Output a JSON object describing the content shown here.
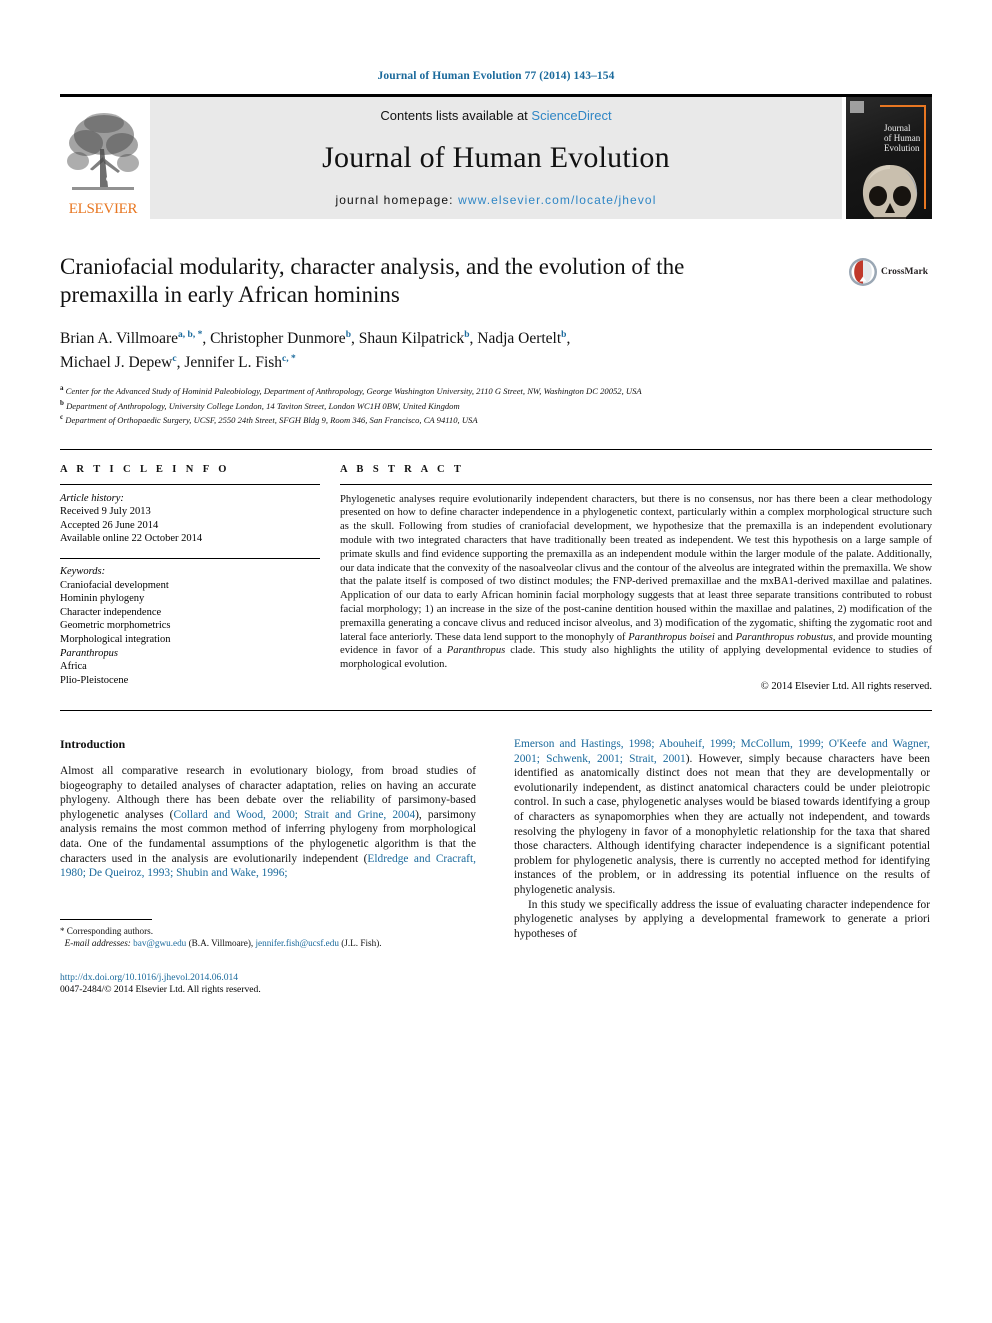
{
  "running_head": "Journal of Human Evolution 77 (2014) 143–154",
  "masthead": {
    "publisher": "ELSEVIER",
    "contents_prefix": "Contents lists available at ",
    "sciencedirect": "ScienceDirect",
    "journal_name": "Journal of Human Evolution",
    "homepage_label": "journal homepage: ",
    "homepage_url": "www.elsevier.com/locate/jhevol",
    "cover_title_line1": "Journal",
    "cover_title_line2": "of Human",
    "cover_title_line3": "Evolution"
  },
  "article": {
    "title": "Craniofacial modularity, character analysis, and the evolution of the premaxilla in early African hominins",
    "crossmark_label": "CrossMark",
    "authors_line1_parts": [
      {
        "name": "Brian A. Villmoare",
        "sup": "a, b, *"
      },
      {
        "name": "Christopher Dunmore",
        "sup": "b"
      },
      {
        "name": "Shaun Kilpatrick",
        "sup": "b"
      },
      {
        "name": "Nadja Oertelt",
        "sup": "b"
      }
    ],
    "authors_line2_parts": [
      {
        "name": "Michael J. Depew",
        "sup": "c"
      },
      {
        "name": "Jennifer L. Fish",
        "sup": "c, *"
      }
    ],
    "affiliations": [
      {
        "marker": "a",
        "text": "Center for the Advanced Study of Hominid Paleobiology, Department of Anthropology, George Washington University, 2110 G Street, NW, Washington DC 20052, USA"
      },
      {
        "marker": "b",
        "text": "Department of Anthropology, University College London, 14 Taviton Street, London WC1H 0BW, United Kingdom"
      },
      {
        "marker": "c",
        "text": "Department of Orthopaedic Surgery, UCSF, 2550 24th Street, SFGH Bldg 9, Room 346, San Francisco, CA 94110, USA"
      }
    ]
  },
  "article_info": {
    "heading": "A R T I C L E   I N F O",
    "history_label": "Article history:",
    "history": [
      "Received 9 July 2013",
      "Accepted 26 June 2014",
      "Available online 22 October 2014"
    ],
    "keywords_label": "Keywords:",
    "keywords": [
      "Craniofacial development",
      "Hominin phylogeny",
      "Character independence",
      "Geometric morphometrics",
      "Morphological integration",
      "Paranthropus",
      "Africa",
      "Plio-Pleistocene"
    ],
    "italic_keywords": [
      "Paranthropus"
    ]
  },
  "abstract": {
    "heading": "A B S T R A C T",
    "paragraph_1": "Phylogenetic analyses require evolutionarily independent characters, but there is no consensus, nor has there been a clear methodology presented on how to define character independence in a phylogenetic context, particularly within a complex morphological structure such as the skull. Following from studies of craniofacial development, we hypothesize that the premaxilla is an independent evolutionary module with two integrated characters that have traditionally been treated as independent. We test this hypothesis on a large sample of primate skulls and find evidence supporting the premaxilla as an independent module within the larger module of the palate. Additionally, our data indicate that the convexity of the nasoalveolar clivus and the contour of the alveolus are integrated within the premaxilla. We show that the palate itself is composed of two distinct modules; the FNP-derived premaxillae and the mxBA1-derived maxillae and palatines. Application of our data to early African hominin facial morphology suggests that at least three separate transitions contributed to robust facial morphology; 1) an increase in the size of the post-canine dentition housed within the maxillae and palatines, 2) modification of the premaxilla generating a concave clivus and reduced incisor alveolus, and 3) modification of the zygomatic, shifting the zygomatic root and lateral face anteriorly. These data lend support to the monophyly of ",
    "italic_1": "Paranthropus boisei",
    "mid_1": " and ",
    "italic_2": "Paranthropus robustus",
    "mid_2": ", and provide mounting evidence in favor of a ",
    "italic_3": "Paranthropus",
    "tail": " clade. This study also highlights the utility of applying developmental evidence to studies of morphological evolution.",
    "copyright": "© 2014 Elsevier Ltd. All rights reserved."
  },
  "body": {
    "heading": "Introduction",
    "left_p1_a": "Almost all comparative research in evolutionary biology, from broad studies of biogeography to detailed analyses of character adaptation, relies on having an accurate phylogeny. Although there has been debate over the reliability of parsimony-based phylogenetic analyses (",
    "left_cite1": "Collard and Wood, 2000; Strait and Grine, 2004",
    "left_p1_b": "), parsimony analysis remains the most common method of inferring phylogeny from morphological data. One of the fundamental assumptions of the phylogenetic algorithm is that the characters used in the analysis are evolutionarily independent (",
    "left_cite2": "Eldredge and Cracraft, 1980; De Queiroz, 1993; Shubin and Wake, 1996;",
    "right_cite_continued": "Emerson and Hastings, 1998; Abouheif, 1999; McCollum, 1999; O'Keefe and Wagner, 2001; Schwenk, 2001; Strait, 2001",
    "right_p1_tail": "). However, simply because characters have been identified as anatomically distinct does not mean that they are developmentally or evolutionarily independent, as distinct anatomical characters could be under pleiotropic control. In such a case, phylogenetic analyses would be biased towards identifying a group of characters as synapomorphies when they are actually not independent, and towards resolving the phylogeny in favor of a monophyletic relationship for the taxa that shared those characters. Although identifying character independence is a significant potential problem for phylogenetic analysis, there is currently no accepted method for identifying instances of the problem, or in addressing its potential influence on the results of phylogenetic analysis.",
    "right_p2": "In this study we specifically address the issue of evaluating character independence for phylogenetic analyses by applying a developmental framework to generate a priori hypotheses of"
  },
  "footnote": {
    "star": "*",
    "corresponding": "Corresponding authors.",
    "email_label": "E-mail addresses:",
    "email_1": "bav@gwu.edu",
    "email_1_owner": "(B.A. Villmoare)",
    "email_2": "jennifer.fish@ucsf.edu",
    "email_2_owner": "(J.L. Fish)."
  },
  "imprint": {
    "doi": "http://dx.doi.org/10.1016/j.jhevol.2014.06.014",
    "issn_line": "0047-2484/© 2014 Elsevier Ltd. All rights reserved."
  },
  "colors": {
    "link_blue": "#1b6a9c",
    "sciencedirect_blue": "#2f86c5",
    "elsevier_orange": "#E87722",
    "banner_grey": "#e9e9e9"
  }
}
